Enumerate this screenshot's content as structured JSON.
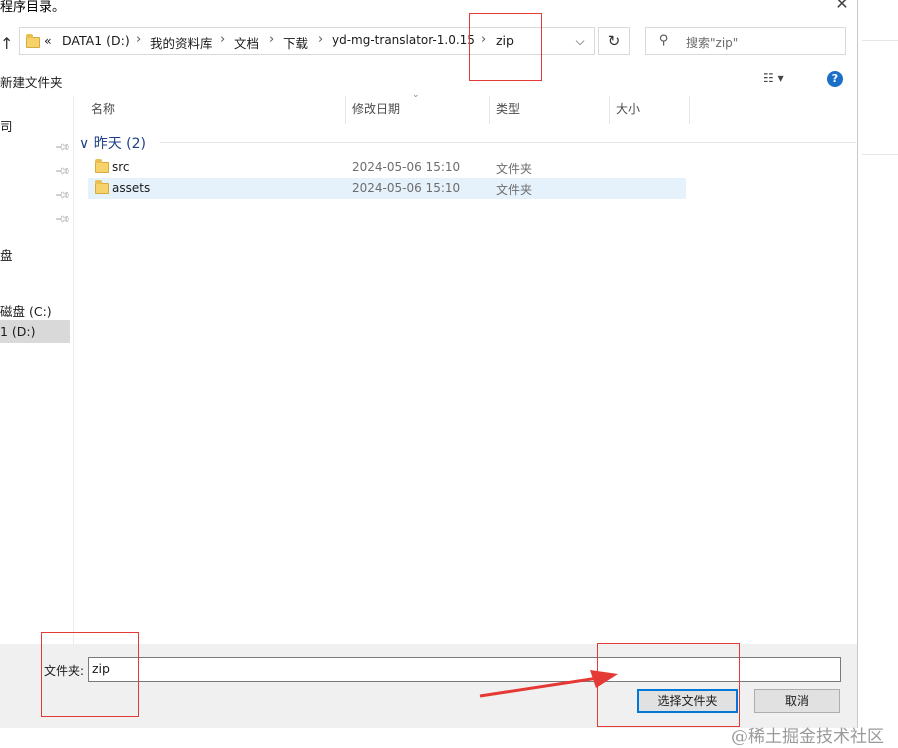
{
  "dialog": {
    "title_fragment": "程序目录。",
    "close_glyph": "✕"
  },
  "address_bar": {
    "overflow": "«",
    "crumbs": [
      "DATA1 (D:)",
      "我的资料库",
      "文档",
      "下载",
      "yd-mg-translator-1.0.15",
      "zip"
    ],
    "separator": "›",
    "dropdown_glyph": "⌵",
    "refresh_glyph": "↻",
    "back_glyph": "↑"
  },
  "search": {
    "placeholder": "搜索\"zip\"",
    "icon": "search-icon"
  },
  "toolbar": {
    "new_folder_label": "新建文件夹",
    "view_glyph": "☷ ▾",
    "help_label": "?"
  },
  "nav_pane": {
    "items": [
      "司",
      "盘",
      "磁盘 (C:)",
      "1 (D:)"
    ],
    "selected_index": 3
  },
  "columns": {
    "name": "名称",
    "date": "修改日期",
    "type": "类型",
    "size": "大小",
    "sort_glyph": "⌄"
  },
  "file_list": {
    "group_label": "昨天 (2)",
    "group_chevron": "∨",
    "rows": [
      {
        "name": "src",
        "date": "2024-05-06 15:10",
        "type": "文件夹",
        "selected": false
      },
      {
        "name": "assets",
        "date": "2024-05-06 15:10",
        "type": "文件夹",
        "selected": true
      }
    ]
  },
  "bottom": {
    "folder_label": "文件夹:",
    "folder_value": "zip",
    "select_button": "选择文件夹",
    "cancel_button": "取消"
  },
  "watermark": "@稀土掘金技术社区",
  "colors": {
    "annotation": "#e53935",
    "selection": "#e5f1fb",
    "group_header": "#1e3f8a",
    "help_icon": "#1a6fc9"
  }
}
